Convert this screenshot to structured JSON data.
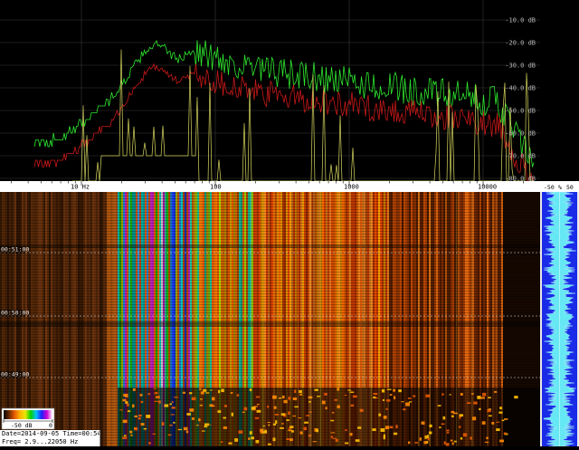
{
  "window": {
    "background": "#000000"
  },
  "spectrum": {
    "db_labels": [
      "-10.0 dB",
      "-20.0 dB",
      "-30.0 dB",
      "-40.0 dB",
      "-50.0 dB",
      "-60.0 dB",
      "-70.0 dB",
      "-80.0 dB"
    ],
    "db_values": [
      -10,
      -20,
      -30,
      -40,
      -50,
      -60,
      -70,
      -80
    ],
    "curves": [
      {
        "name": "green",
        "color": "#2ee82e"
      },
      {
        "name": "red",
        "color": "#c81818"
      },
      {
        "name": "yellow",
        "color": "#d8d860"
      }
    ]
  },
  "freq_axis": {
    "ticks": [
      {
        "label": "10 Hz",
        "hz": 10
      },
      {
        "label": "100",
        "hz": 100
      },
      {
        "label": "1000",
        "hz": 1000
      },
      {
        "label": "10000",
        "hz": 10000
      }
    ],
    "range_hz": [
      2.9,
      22050
    ]
  },
  "waterfall": {
    "time_labels": [
      "00:51:00",
      "00:50:00",
      "00:49:00"
    ],
    "time_label_values": [
      51,
      50,
      49
    ]
  },
  "meter": {
    "scale_labels": [
      "-50",
      "%",
      "50"
    ],
    "waveform_color": "#66e8f4",
    "background": "#1a2be8"
  },
  "color_scale": {
    "labels": [
      "-50 dB",
      "0"
    ],
    "stops": [
      "#000000",
      "#6a2a00",
      "#e85a00",
      "#ffb000",
      "#e8e800",
      "#00d000",
      "#00c0ff",
      "#2020ff",
      "#d000d0",
      "#ffffff"
    ]
  },
  "status": {
    "datetime": "Date=2014-09-05 Time=00:54",
    "freq": "Freq= 2.9...22050 Hz"
  }
}
